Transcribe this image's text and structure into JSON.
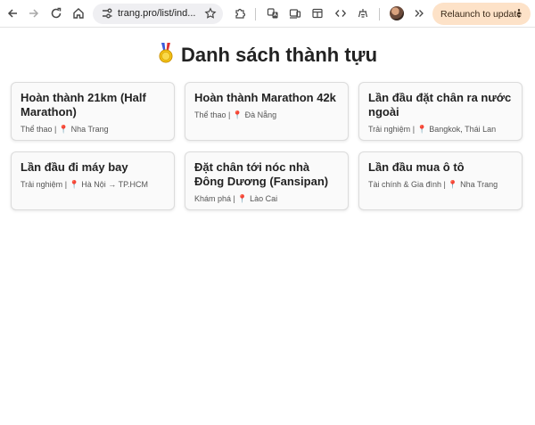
{
  "browser": {
    "url": "trang.pro/list/ind...",
    "relaunch_label": "Relaunch to update",
    "menu_label": "⋮"
  },
  "page": {
    "title": "Danh sách thành tựu",
    "title_icon": "medal-icon"
  },
  "achievements": [
    {
      "title": "Hoàn thành 21km (Half Marathon)",
      "category": "Thể thao",
      "separator": " | ",
      "pin": "📍",
      "location": "Nha Trang"
    },
    {
      "title": "Hoàn thành Marathon 42k",
      "category": "Thể thao",
      "separator": " | ",
      "pin": "📍",
      "location": "Đà Nẵng"
    },
    {
      "title": "Lần đầu đặt chân ra nước ngoài",
      "category": "Trải nghiệm",
      "separator": " | ",
      "pin": "📍",
      "location": "Bangkok, Thái Lan"
    },
    {
      "title": "Lần đầu đi máy bay",
      "category": "Trải nghiệm",
      "separator": " | ",
      "pin": "📍",
      "location": "Hà Nội → TP.HCM"
    },
    {
      "title": "Đặt chân tới nóc nhà Đông Dương (Fansipan)",
      "category": "Khám phá",
      "separator": " | ",
      "pin": "📍",
      "location": "Lào Cai"
    },
    {
      "title": "Lần đầu mua ô tô",
      "category": "Tài chính & Gia đình",
      "separator": " | ",
      "pin": "📍",
      "location": "Nha Trang"
    }
  ]
}
